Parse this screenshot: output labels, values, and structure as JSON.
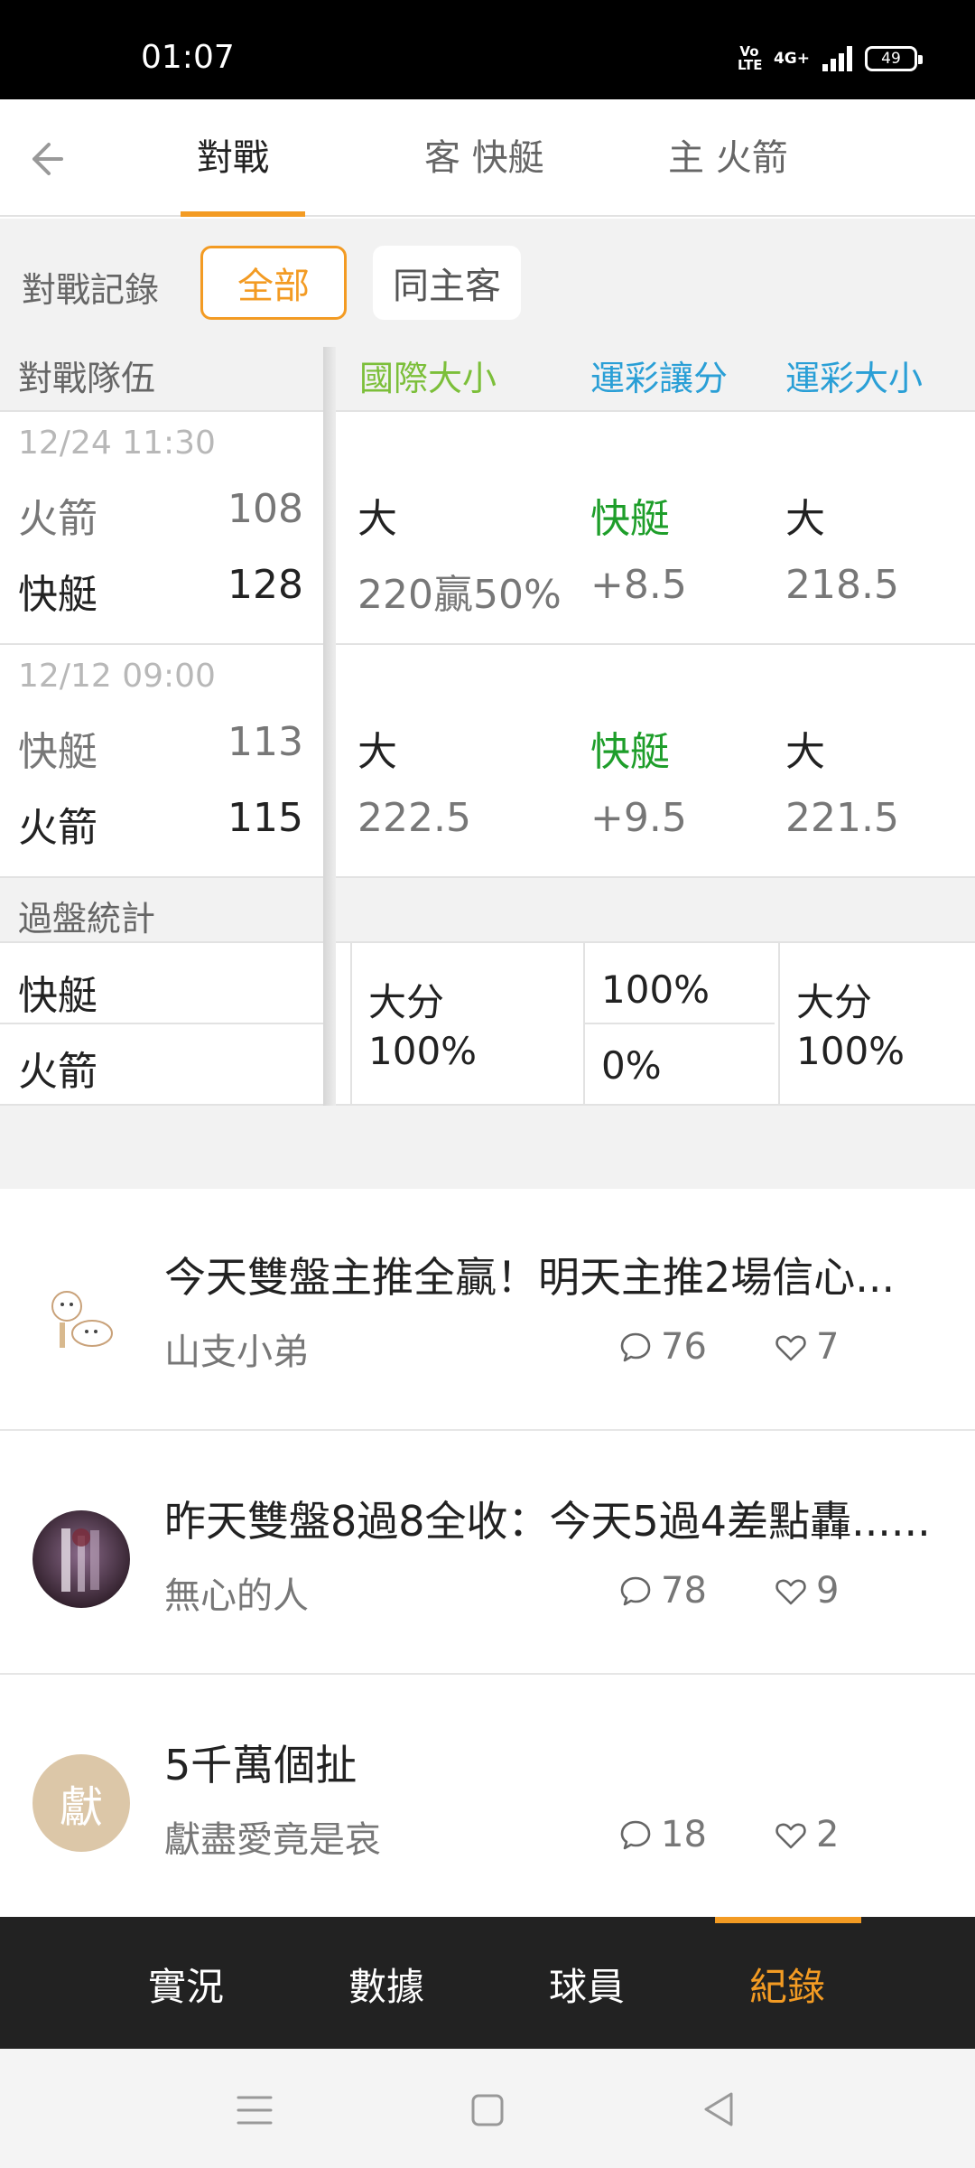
{
  "status_bar": {
    "time": "01:07",
    "volte": "Vo LTE",
    "network": "4G+",
    "battery": "49"
  },
  "header": {
    "back_icon": "arrow-left-icon",
    "tabs": [
      {
        "label": "對戰",
        "active": true
      },
      {
        "label": "客 快艇",
        "active": false
      },
      {
        "label": "主 火箭",
        "active": false
      }
    ]
  },
  "filter": {
    "label": "對戰記錄",
    "all_label": "全部",
    "same_home_label": "同主客"
  },
  "table": {
    "columns": {
      "team": "對戰隊伍",
      "intl_total": "國際大小",
      "lottery_spread": "運彩讓分",
      "lottery_total": "運彩大小"
    },
    "colors": {
      "intl_total": "#7cbf3a",
      "lottery": "#2a9fd6",
      "accent": "#f39b23",
      "win_green": "#1e9e2a"
    },
    "matches": [
      {
        "date": "12/24 11:30",
        "team1": "火箭",
        "score1": "108",
        "team2": "快艇",
        "score2": "128",
        "intl_result": "大",
        "intl_line": "220贏50%",
        "spread_winner": "快艇",
        "spread_line": "+8.5",
        "total_result": "大",
        "total_line": "218.5"
      },
      {
        "date": "12/12 09:00",
        "team1": "快艇",
        "score1": "113",
        "team2": "火箭",
        "score2": "115",
        "intl_result": "大",
        "intl_line": "222.5",
        "spread_winner": "快艇",
        "spread_line": "+9.5",
        "total_result": "大",
        "total_line": "221.5"
      }
    ],
    "stats": {
      "label": "過盤統計",
      "team1": "快艇",
      "team2": "火箭",
      "intl_label": "大分",
      "intl_pct": "100%",
      "spread_team1_pct": "100%",
      "spread_team2_pct": "0%",
      "total_label": "大分",
      "total_pct": "100%"
    }
  },
  "posts": [
    {
      "title": "今天雙盤主推全贏！明天主推2場信心...",
      "author": "山支小弟",
      "comments": "76",
      "likes": "7",
      "avatar": "cat-illustration"
    },
    {
      "title": "昨天雙盤8過8全收：今天5過4差點轟......",
      "author": "無心的人",
      "comments": "78",
      "likes": "9",
      "avatar": "dark-photo"
    },
    {
      "title": "5千萬個扯",
      "author": "獻盡愛竟是哀",
      "comments": "18",
      "likes": "2",
      "avatar_text": "獻",
      "avatar_color": "#dcc7a8"
    }
  ],
  "bottom_nav": [
    {
      "label": "實況",
      "active": false
    },
    {
      "label": "數據",
      "active": false
    },
    {
      "label": "球員",
      "active": false
    },
    {
      "label": "紀錄",
      "active": true
    }
  ],
  "system_nav": [
    "menu-icon",
    "home-square-icon",
    "back-triangle-icon"
  ]
}
